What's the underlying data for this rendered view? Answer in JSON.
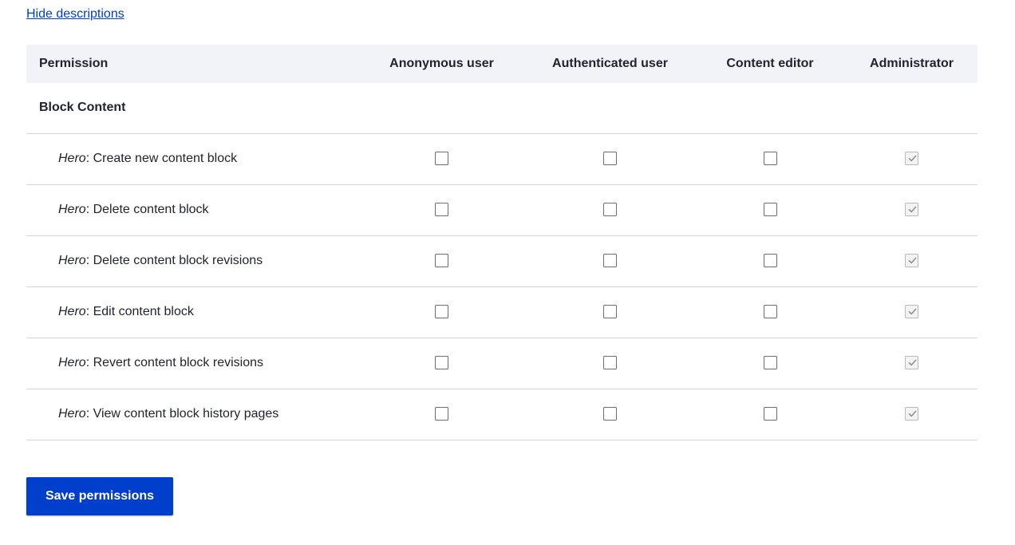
{
  "toggle_descriptions": "Hide descriptions",
  "table": {
    "headers": {
      "permission": "Permission",
      "roles": [
        "Anonymous user",
        "Authenticated user",
        "Content editor",
        "Administrator"
      ]
    },
    "module": "Block Content",
    "rows": [
      {
        "prefix": "Hero",
        "label": ": Create new content block",
        "checked": [
          false,
          false,
          false,
          true
        ]
      },
      {
        "prefix": "Hero",
        "label": ": Delete content block",
        "checked": [
          false,
          false,
          false,
          true
        ]
      },
      {
        "prefix": "Hero",
        "label": ": Delete content block revisions",
        "checked": [
          false,
          false,
          false,
          true
        ]
      },
      {
        "prefix": "Hero",
        "label": ": Edit content block",
        "checked": [
          false,
          false,
          false,
          true
        ]
      },
      {
        "prefix": "Hero",
        "label": ": Revert content block revisions",
        "checked": [
          false,
          false,
          false,
          true
        ]
      },
      {
        "prefix": "Hero",
        "label": ": View content block history pages",
        "checked": [
          false,
          false,
          false,
          true
        ]
      }
    ]
  },
  "save_button": "Save permissions",
  "colors": {
    "accent": "#003ecc",
    "header_bg": "#f2f3f8",
    "row_border": "#d3d4d9"
  }
}
